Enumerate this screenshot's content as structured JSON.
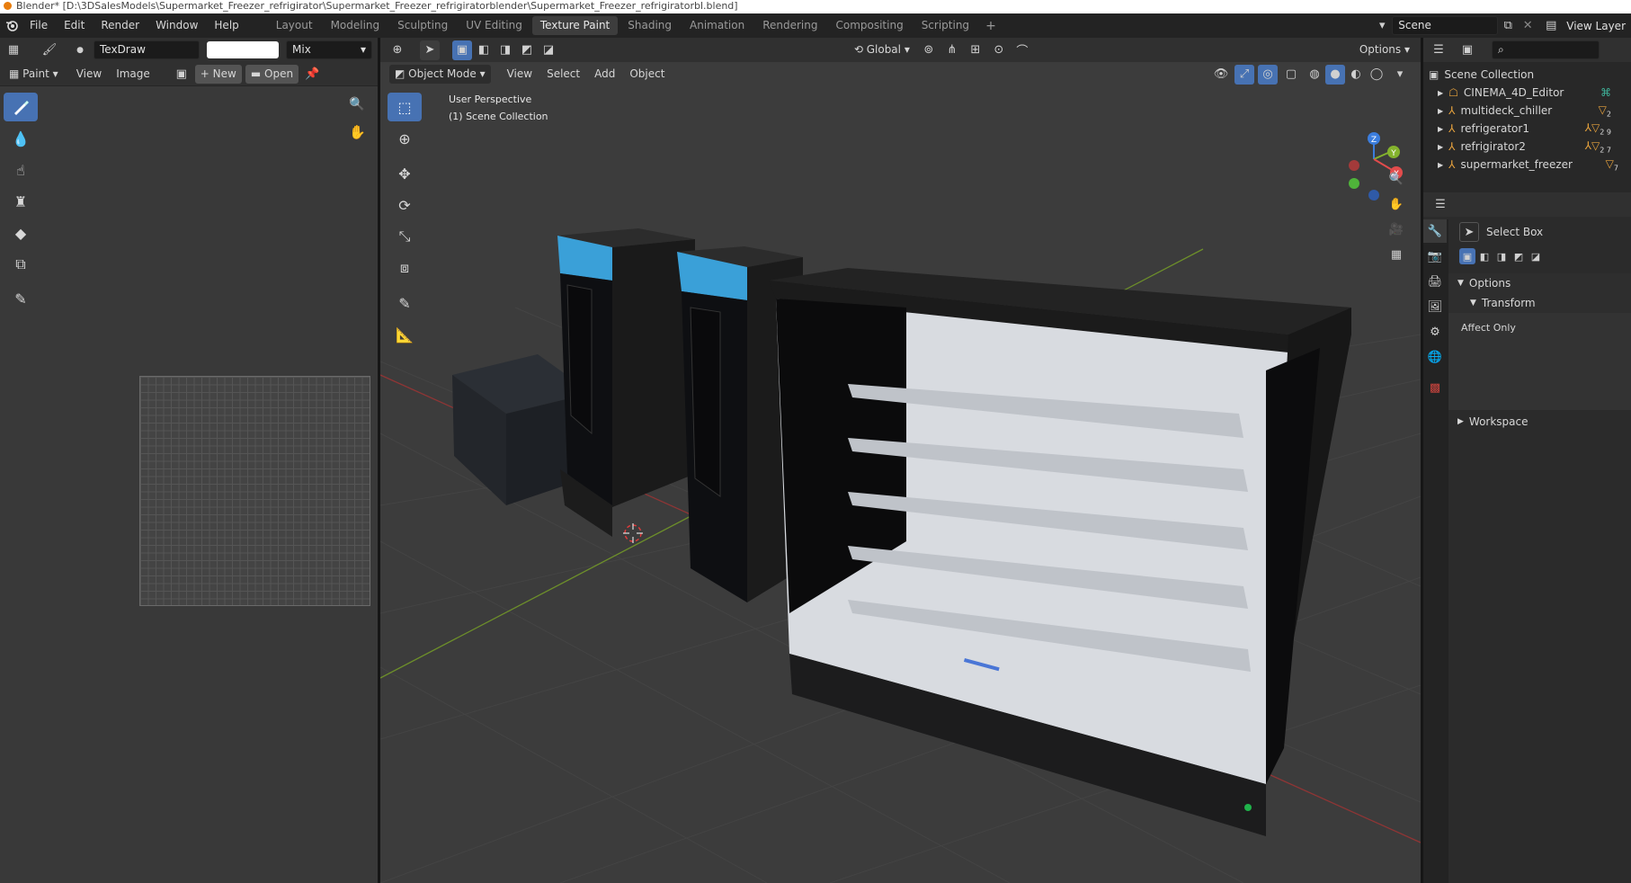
{
  "window": {
    "title": "Blender* [D:\\3DSalesModels\\Supermarket_Freezer_refrigirator\\Supermarket_Freezer_refrigiratorblender\\Supermarket_Freezer_refrigiratorbl.blend]"
  },
  "menu": [
    "File",
    "Edit",
    "Render",
    "Window",
    "Help"
  ],
  "workspaces": [
    "Layout",
    "Modeling",
    "Sculpting",
    "UV Editing",
    "Texture Paint",
    "Shading",
    "Animation",
    "Rendering",
    "Compositing",
    "Scripting"
  ],
  "active_workspace": "Texture Paint",
  "scene_name": "Scene",
  "view_layer": "View Layer",
  "image_editor": {
    "brush": "TexDraw",
    "blend": "Mix",
    "mode": "Paint",
    "view": "View",
    "image": "Image",
    "new": "New",
    "open": "Open"
  },
  "viewport": {
    "orientation": "Global",
    "options": "Options",
    "mode": "Object Mode",
    "menus": [
      "View",
      "Select",
      "Add",
      "Object"
    ],
    "overlay_title": "User Perspective",
    "overlay_collection": "(1) Scene Collection",
    "gizmo": {
      "x": "X",
      "y": "Y",
      "z": "Z"
    }
  },
  "outliner": {
    "root": "Scene Collection",
    "items": [
      {
        "name": "CINEMA_4D_Editor",
        "badge": ""
      },
      {
        "name": "multideck_chiller",
        "badge": "2"
      },
      {
        "name": "refrigerator1",
        "badge": "2 9"
      },
      {
        "name": "refrigirator2",
        "badge": "2 7"
      },
      {
        "name": "supermarket_freezer",
        "badge": "7"
      }
    ]
  },
  "properties": {
    "tool": "Select Box",
    "options": "Options",
    "transform": "Transform",
    "affect_only": "Affect Only",
    "workspace": "Workspace"
  },
  "colors": {
    "accent": "#4772b3",
    "bg": "#3c3c3c",
    "header": "#303030"
  }
}
